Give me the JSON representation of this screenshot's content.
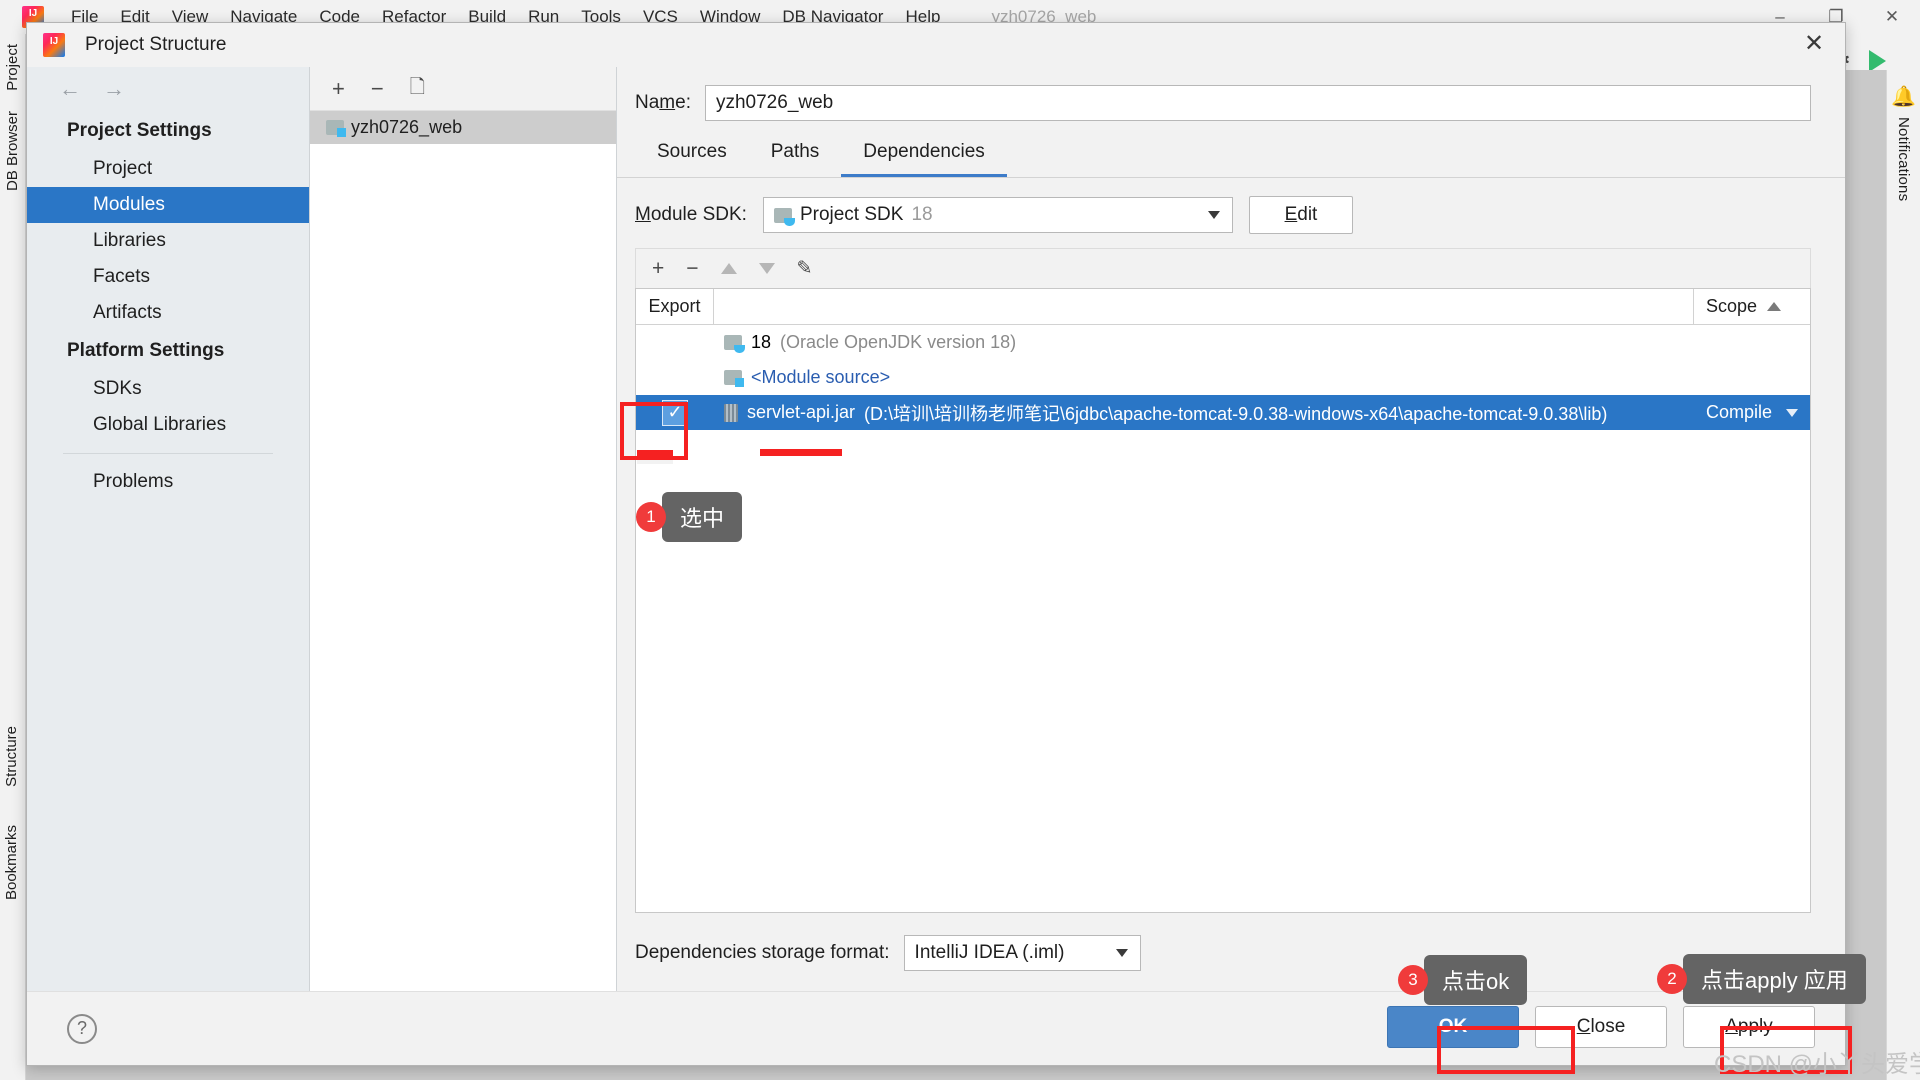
{
  "ide": {
    "app_icon": "intellij-logo-icon",
    "project_title": "yzh0726_web",
    "menu": [
      "File",
      "Edit",
      "View",
      "Navigate",
      "Code",
      "Refactor",
      "Build",
      "Run",
      "Tools",
      "VCS",
      "Window",
      "DB Navigator",
      "Help"
    ],
    "window_controls": {
      "minimize": "–",
      "maximize": "❐",
      "close": "✕"
    },
    "right_icons": {
      "settings": "gear-icon",
      "run": "run-icon"
    },
    "left_tabs": [
      "Project",
      "DB Browser",
      "Structure",
      "Bookmarks"
    ],
    "right_tabs": [
      "Notifications"
    ]
  },
  "dialog": {
    "title": "Project Structure",
    "close_label": "✕",
    "nav": {
      "back": "←",
      "forward": "→"
    },
    "settings": {
      "groups": [
        {
          "label": "Project Settings",
          "items": [
            "Project",
            "Modules",
            "Libraries",
            "Facets",
            "Artifacts"
          ]
        },
        {
          "label": "Platform Settings",
          "items": [
            "SDKs",
            "Global Libraries"
          ]
        }
      ],
      "extra_items": [
        "Problems"
      ],
      "active_item": "Modules"
    },
    "modules_panel": {
      "toolbar": {
        "add": "+",
        "remove": "−",
        "copy": "copy-icon"
      },
      "items": [
        {
          "name": "yzh0726_web",
          "icon": "module-folder-icon",
          "selected": true
        }
      ]
    },
    "name_field": {
      "label": "Na",
      "label_mnemonic": "m",
      "label_rest": "e:",
      "value": "yzh0726_web"
    },
    "tabs": [
      {
        "label": "Sources",
        "active": false
      },
      {
        "label": "Paths",
        "active": false
      },
      {
        "label": "Dependencies",
        "active": true
      }
    ],
    "module_sdk": {
      "label_pre": "",
      "label_mnemonic": "M",
      "label_rest": "odule SDK:",
      "value": "Project SDK",
      "version": "18",
      "edit_button": {
        "pre": "",
        "mnemonic": "E",
        "rest": "dit"
      }
    },
    "dep_toolbar": {
      "add": "+",
      "remove": "−",
      "up": "move-up-icon",
      "down": "move-down-icon",
      "edit": "edit-pencil-icon"
    },
    "dep_table": {
      "columns": [
        "Export",
        "",
        "Scope"
      ],
      "sort_indicator": "ascending",
      "rows": [
        {
          "export_checked": false,
          "icon": "jdk-icon",
          "name": "18",
          "detail": "(Oracle OpenJDK version 18)",
          "scope": "",
          "selected": false,
          "style": "jdk"
        },
        {
          "export_checked": false,
          "icon": "module-source-icon",
          "name": "<Module source>",
          "detail": "",
          "scope": "",
          "selected": false,
          "style": "module-source"
        },
        {
          "export_checked": true,
          "icon": "jar-icon",
          "name": "servlet-api.jar",
          "detail": "(D:\\培训\\培训杨老师笔记\\6jdbc\\apache-tomcat-9.0.38-windows-x64\\apache-tomcat-9.0.38\\lib)",
          "scope": "Compile",
          "selected": true,
          "style": "jar"
        }
      ]
    },
    "storage": {
      "label": "Dependencies storage format:",
      "value": "IntelliJ IDEA (.iml)"
    },
    "footer": {
      "help": "?",
      "ok": "OK",
      "close": {
        "pre": "",
        "mnemonic": "C",
        "rest": "lose"
      },
      "apply": {
        "pre": "",
        "mnemonic": "A",
        "rest": "pply"
      }
    }
  },
  "annotations": [
    {
      "number": "1",
      "text": "选中"
    },
    {
      "number": "2",
      "text": "点击apply 应用"
    },
    {
      "number": "3",
      "text": "点击ok"
    }
  ],
  "watermark": "CSDN @小丫头爱学习",
  "colors": {
    "accent_blue": "#2a76c6",
    "primary_button": "#4a86c8",
    "annotation_red": "#f03b3b",
    "bubble_gray": "#646464",
    "sidebar_bg": "#e8ecef"
  }
}
